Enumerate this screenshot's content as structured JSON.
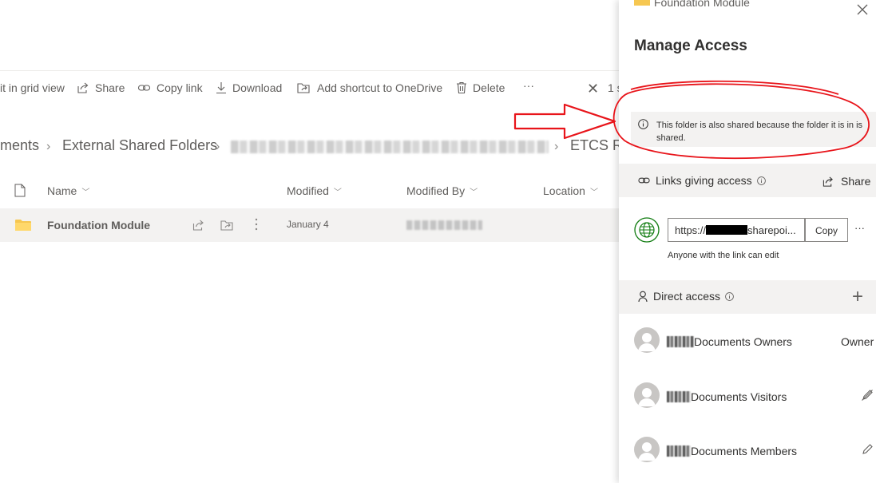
{
  "toolbar": {
    "items": [
      {
        "label": "it in grid view",
        "icon": "grid-view-icon"
      },
      {
        "label": "Share",
        "icon": "share-icon"
      },
      {
        "label": "Copy link",
        "icon": "link-icon"
      },
      {
        "label": "Download",
        "icon": "download-icon"
      },
      {
        "label": "Add shortcut to OneDrive",
        "icon": "shortcut-icon"
      },
      {
        "label": "Delete",
        "icon": "trash-icon"
      },
      {
        "label": "···",
        "icon": "more-icon"
      }
    ],
    "close_glyph": "✕",
    "selected_label": "1 s"
  },
  "breadcrumb": {
    "items": [
      "ments",
      "External Shared Folders",
      "ETCS Re"
    ]
  },
  "columns": {
    "name": "Name",
    "modified": "Modified",
    "modified_by": "Modified By",
    "location": "Location"
  },
  "file_row": {
    "name": "Foundation Module",
    "modified": "January 4"
  },
  "panel": {
    "item_name": "Foundation Module",
    "title": "Manage Access",
    "info_text": "This folder is also shared because the folder it is in is shared.",
    "links_section": {
      "label": "Links giving access",
      "share_label": "Share"
    },
    "link": {
      "url_prefix": "https://",
      "url_suffix": "sharepoi...",
      "copy_label": "Copy",
      "more_label": "···",
      "permission_text": "Anyone with the link can edit"
    },
    "direct_section": {
      "label": "Direct access",
      "add_glyph": "+"
    },
    "members": [
      {
        "name": "Documents Owners",
        "role": "Owner"
      },
      {
        "name": "Documents Visitors",
        "role": ""
      },
      {
        "name": "Documents Members",
        "role": ""
      }
    ]
  },
  "colors": {
    "annotation_red": "#e8141a",
    "folder_yellow": "#f6c751",
    "globe_green": "#107c10",
    "text_secondary": "#605e5c"
  }
}
